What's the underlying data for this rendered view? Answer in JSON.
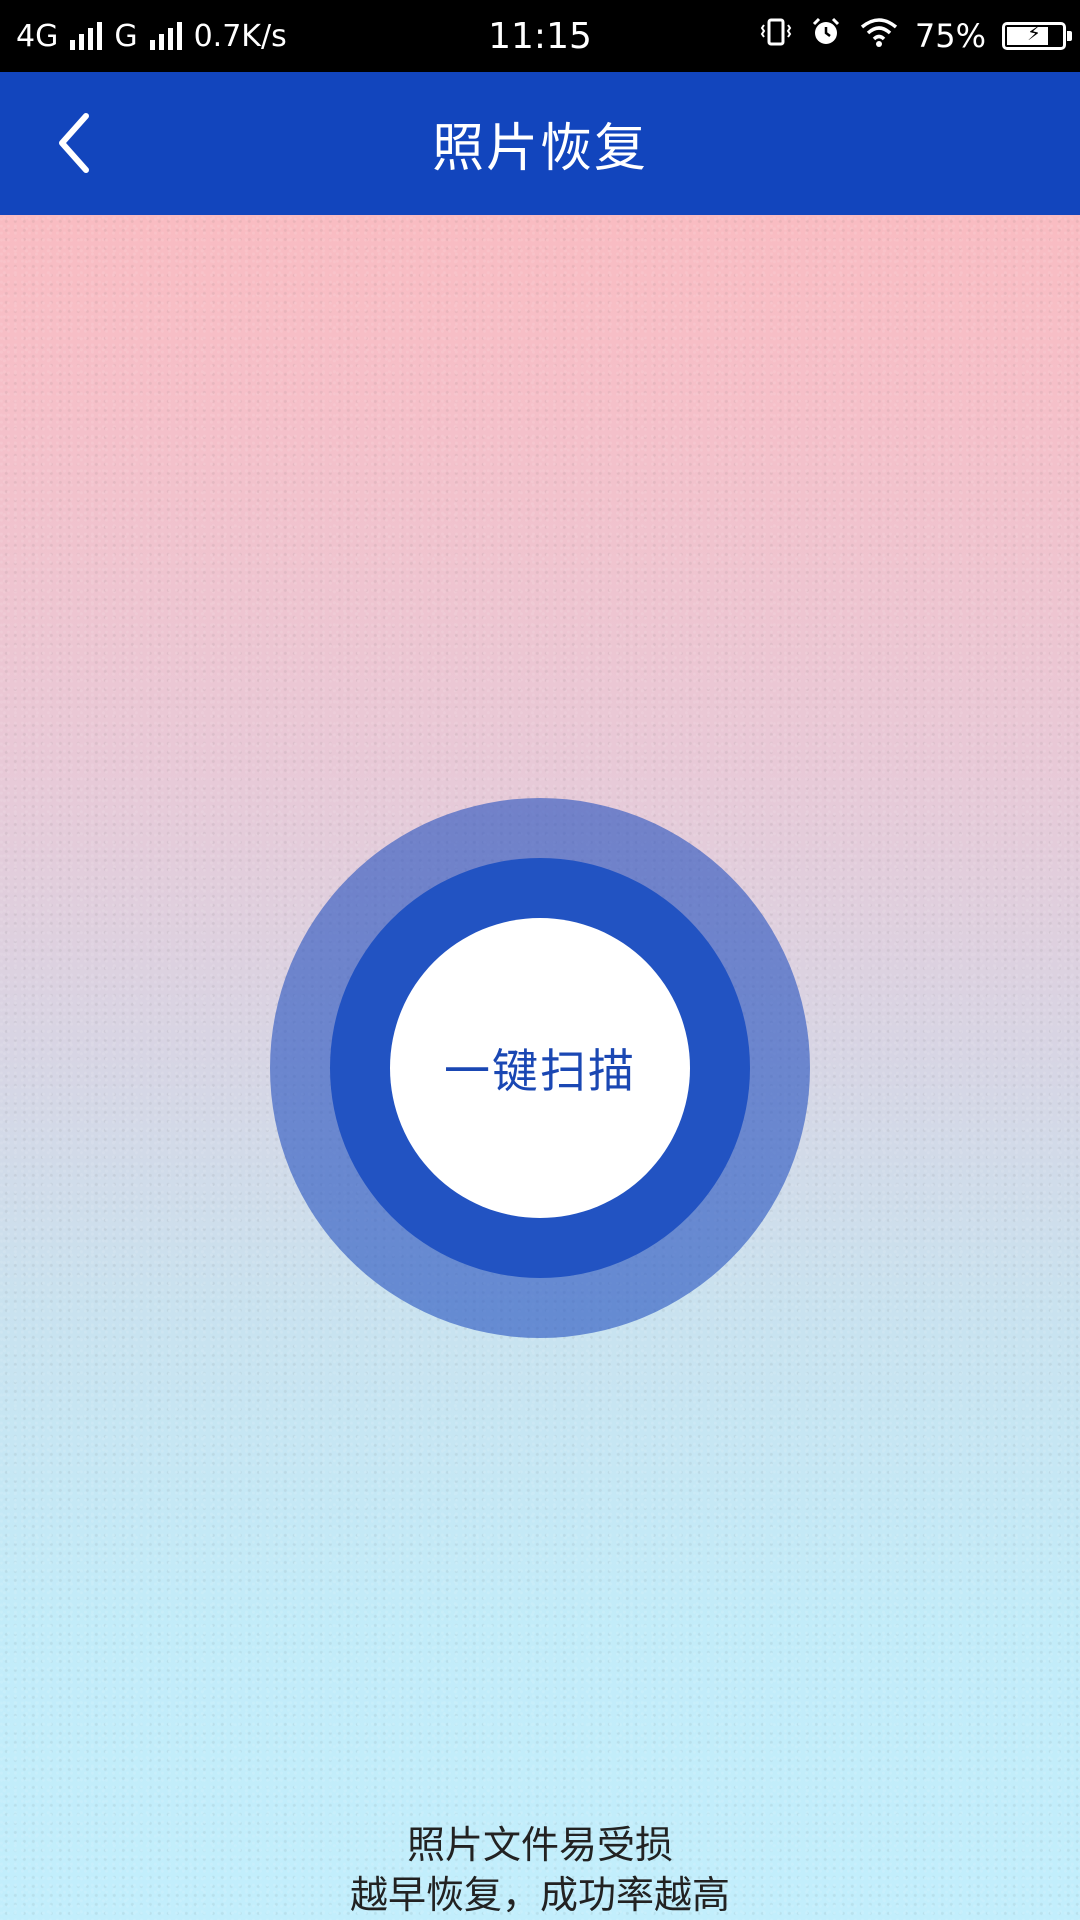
{
  "status_bar": {
    "network_1": "4G",
    "network_2": "G",
    "speed": "0.7K/s",
    "time": "11:15",
    "battery_percent": "75%",
    "battery_level": 0.75,
    "icons": [
      "vibrate-icon",
      "alarm-icon",
      "wifi-icon",
      "battery-charging-icon"
    ]
  },
  "header": {
    "back_icon": "chevron-left-icon",
    "title": "照片恢复",
    "background_color": "#1245bd"
  },
  "scan": {
    "button_label": "一键扫描",
    "label_color": "#1a47b3",
    "ring_color": "#2253c2"
  },
  "tip": {
    "line1": "照片文件易受损",
    "line2": "越早恢复，成功率越高"
  }
}
